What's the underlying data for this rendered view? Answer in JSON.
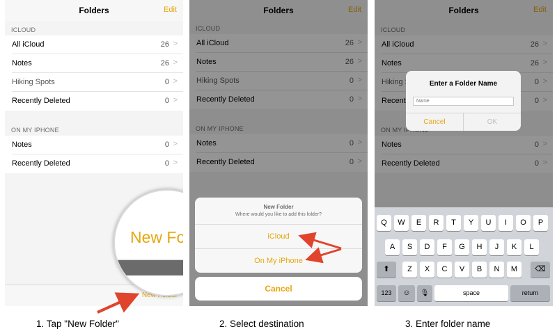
{
  "colors": {
    "accent": "#e6a70f",
    "arrow": "#e0442c",
    "keyboard_bg": "#d1d4d9"
  },
  "nav": {
    "title": "Folders",
    "edit": "Edit"
  },
  "sections": {
    "icloud": {
      "header": "ICLOUD",
      "rows": [
        {
          "label": "All iCloud",
          "count": "26"
        },
        {
          "label": "Notes",
          "count": "26"
        },
        {
          "label": "Hiking Spots",
          "count": "0"
        },
        {
          "label": "Recently Deleted",
          "count": "0"
        }
      ]
    },
    "iphone": {
      "header": "ON MY IPHONE",
      "rows": [
        {
          "label": "Notes",
          "count": "0"
        },
        {
          "label": "Recently Deleted",
          "count": "0"
        }
      ]
    }
  },
  "chevron": ">",
  "toolbar": {
    "new_folder": "New Folder"
  },
  "magnifier": {
    "text": "New Folder"
  },
  "action_sheet": {
    "title": "New Folder",
    "message": "Where would you like to add this folder?",
    "option_icloud": "iCloud",
    "option_iphone": "On My iPhone",
    "cancel": "Cancel"
  },
  "alert": {
    "title": "Enter a Folder Name",
    "placeholder": "Name",
    "cancel": "Cancel",
    "ok": "OK"
  },
  "keyboard": {
    "row1": [
      "Q",
      "W",
      "E",
      "R",
      "T",
      "Y",
      "U",
      "I",
      "O",
      "P"
    ],
    "row2": [
      "A",
      "S",
      "D",
      "F",
      "G",
      "H",
      "J",
      "K",
      "L"
    ],
    "row3": [
      "Z",
      "X",
      "C",
      "V",
      "B",
      "N",
      "M"
    ],
    "shift_icon": "⬆",
    "delete_icon": "⌫",
    "numbers_label": "123",
    "emoji_icon": "☺",
    "mic_icon": "🎙",
    "space_label": "space",
    "return_label": "return"
  },
  "captions": [
    "1. Tap \"New Folder\"",
    "2. Select destination",
    "3. Enter folder name"
  ]
}
